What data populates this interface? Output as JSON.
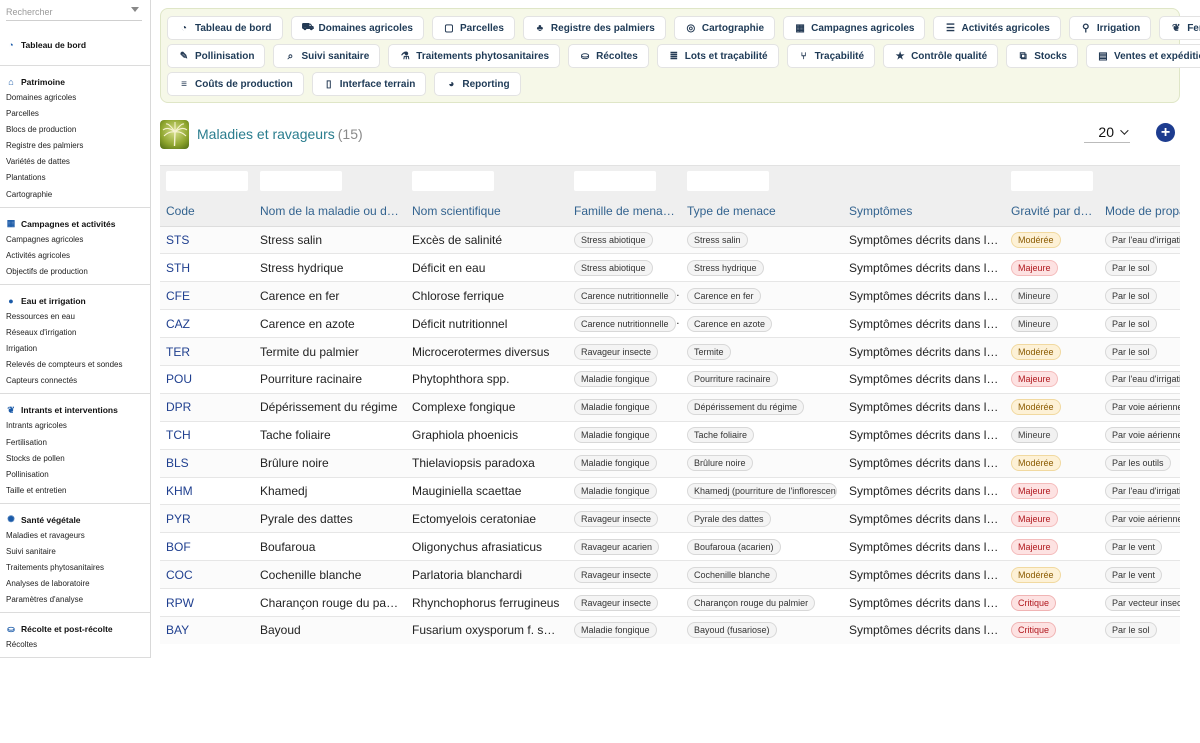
{
  "search": {
    "placeholder": "Rechercher"
  },
  "sidebar": {
    "top": {
      "label": "Tableau de bord",
      "icon": "gauge-icon"
    },
    "groups": [
      {
        "title": "Patrimoine",
        "icon": "building-icon",
        "items": [
          "Domaines agricoles",
          "Parcelles",
          "Blocs de production",
          "Registre des palmiers",
          "Variétés de dattes",
          "Plantations",
          "Cartographie"
        ]
      },
      {
        "title": "Campagnes et activités",
        "icon": "calendar-icon",
        "items": [
          "Campagnes agricoles",
          "Activités agricoles",
          "Objectifs de production"
        ]
      },
      {
        "title": "Eau et irrigation",
        "icon": "droplet-icon",
        "items": [
          "Ressources en eau",
          "Réseaux d'irrigation",
          "Irrigation",
          "Relevés de compteurs et sondes",
          "Capteurs connectés"
        ]
      },
      {
        "title": "Intrants et interventions",
        "icon": "leaf-icon",
        "items": [
          "Intrants agricoles",
          "Fertilisation",
          "Stocks de pollen",
          "Pollinisation",
          "Taille et entretien"
        ]
      },
      {
        "title": "Santé végétale",
        "icon": "virus-icon",
        "items": [
          "Maladies et ravageurs",
          "Suivi sanitaire",
          "Traitements phytosanitaires",
          "Analyses de laboratoire",
          "Paramètres d'analyse"
        ]
      },
      {
        "title": "Récolte et post-récolte",
        "icon": "basket-icon",
        "items": [
          "Récoltes"
        ]
      }
    ]
  },
  "toolbar": {
    "rows": [
      [
        {
          "label": "Tableau de bord",
          "icon": "gauge-icon",
          "glyph": "◔"
        },
        {
          "label": "Domaines agricoles",
          "icon": "tractor-icon",
          "glyph": "⛟"
        },
        {
          "label": "Parcelles",
          "icon": "border-icon",
          "glyph": "▢"
        },
        {
          "label": "Registre des palmiers",
          "icon": "tree-icon",
          "glyph": "♣"
        },
        {
          "label": "Cartographie",
          "icon": "compass-icon",
          "glyph": "◎"
        },
        {
          "label": "Campagnes agricoles",
          "icon": "calendar-icon",
          "glyph": "▦"
        },
        {
          "label": "Activités agricoles",
          "icon": "list-icon",
          "glyph": "☰"
        },
        {
          "label": "Irrigation",
          "icon": "faucet-icon",
          "glyph": "⚲"
        },
        {
          "label": "Fertilisation",
          "icon": "leaf-icon",
          "glyph": "❦"
        }
      ],
      [
        {
          "label": "Pollinisation",
          "icon": "brush-icon",
          "glyph": "✎"
        },
        {
          "label": "Suivi sanitaire",
          "icon": "search-icon",
          "glyph": "⌕"
        },
        {
          "label": "Traitements phytosanitaires",
          "icon": "spray-icon",
          "glyph": "⚗"
        },
        {
          "label": "Récoltes",
          "icon": "basket-icon",
          "glyph": "⛀"
        },
        {
          "label": "Lots et traçabilité",
          "icon": "list-icon",
          "glyph": "≣"
        },
        {
          "label": "Traçabilité",
          "icon": "sitemap-icon",
          "glyph": "⑂"
        },
        {
          "label": "Contrôle qualité",
          "icon": "star-icon",
          "glyph": "★"
        },
        {
          "label": "Stocks",
          "icon": "cubes-icon",
          "glyph": "⧉"
        },
        {
          "label": "Ventes et expéditions",
          "icon": "file-invoice-icon",
          "glyph": "▤"
        }
      ],
      [
        {
          "label": "Coûts de production",
          "icon": "coins-icon",
          "glyph": "≡"
        },
        {
          "label": "Interface terrain",
          "icon": "mobile-icon",
          "glyph": "▯"
        },
        {
          "label": "Reporting",
          "icon": "chart-pie-icon",
          "glyph": "◕"
        }
      ]
    ]
  },
  "header": {
    "title": "Maladies et ravageurs",
    "count": "(15)",
    "page_size": "20"
  },
  "table": {
    "columns": [
      "Code",
      "Nom de la maladie ou du ravageur",
      "Nom scientifique",
      "Famille de menace",
      "Type de menace",
      "Symptômes",
      "Gravité par défaut",
      "Mode de propagation"
    ],
    "rows": [
      {
        "code": "STS",
        "nom": "Stress salin",
        "sci": "Excès de salinité",
        "famille": "Stress abiotique",
        "type": "Stress salin",
        "symptomes": "Symptômes décrits dans la fiche",
        "gravite": "Modérée",
        "mode": "Par l'eau d'irrigation"
      },
      {
        "code": "STH",
        "nom": "Stress hydrique",
        "sci": "Déficit en eau",
        "famille": "Stress abiotique",
        "type": "Stress hydrique",
        "symptomes": "Symptômes décrits dans la fiche",
        "gravite": "Majeure",
        "mode": "Par le sol"
      },
      {
        "code": "CFE",
        "nom": "Carence en fer",
        "sci": "Chlorose ferrique",
        "famille": "Carence nutritionnelle",
        "type": "Carence en fer",
        "symptomes": "Symptômes décrits dans la fiche",
        "gravite": "Mineure",
        "mode": "Par le sol"
      },
      {
        "code": "CAZ",
        "nom": "Carence en azote",
        "sci": "Déficit nutritionnel",
        "famille": "Carence nutritionnelle",
        "type": "Carence en azote",
        "symptomes": "Symptômes décrits dans la fiche",
        "gravite": "Mineure",
        "mode": "Par le sol"
      },
      {
        "code": "TER",
        "nom": "Termite du palmier",
        "sci": "Microcerotermes diversus",
        "famille": "Ravageur insecte",
        "type": "Termite",
        "symptomes": "Symptômes décrits dans la fiche",
        "gravite": "Modérée",
        "mode": "Par le sol"
      },
      {
        "code": "POU",
        "nom": "Pourriture racinaire",
        "sci": "Phytophthora spp.",
        "famille": "Maladie fongique",
        "type": "Pourriture racinaire",
        "symptomes": "Symptômes décrits dans la fiche",
        "gravite": "Majeure",
        "mode": "Par l'eau d'irrigation"
      },
      {
        "code": "DPR",
        "nom": "Dépérissement du régime",
        "sci": "Complexe fongique",
        "famille": "Maladie fongique",
        "type": "Dépérissement du régime",
        "symptomes": "Symptômes décrits dans la fiche",
        "gravite": "Modérée",
        "mode": "Par voie aérienne"
      },
      {
        "code": "TCH",
        "nom": "Tache foliaire",
        "sci": "Graphiola phoenicis",
        "famille": "Maladie fongique",
        "type": "Tache foliaire",
        "symptomes": "Symptômes décrits dans la fiche",
        "gravite": "Mineure",
        "mode": "Par voie aérienne"
      },
      {
        "code": "BLS",
        "nom": "Brûlure noire",
        "sci": "Thielaviopsis paradoxa",
        "famille": "Maladie fongique",
        "type": "Brûlure noire",
        "symptomes": "Symptômes décrits dans la fiche",
        "gravite": "Modérée",
        "mode": "Par les outils"
      },
      {
        "code": "KHM",
        "nom": "Khamedj",
        "sci": "Mauginiella scaettae",
        "famille": "Maladie fongique",
        "type": "Khamedj (pourriture de l'inflorescence)",
        "symptomes": "Symptômes décrits dans la fiche",
        "gravite": "Majeure",
        "mode": "Par l'eau d'irrigation"
      },
      {
        "code": "PYR",
        "nom": "Pyrale des dattes",
        "sci": "Ectomyelois ceratoniae",
        "famille": "Ravageur insecte",
        "type": "Pyrale des dattes",
        "symptomes": "Symptômes décrits dans la fiche",
        "gravite": "Majeure",
        "mode": "Par voie aérienne"
      },
      {
        "code": "BOF",
        "nom": "Boufaroua",
        "sci": "Oligonychus afrasiaticus",
        "famille": "Ravageur acarien",
        "type": "Boufaroua (acarien)",
        "symptomes": "Symptômes décrits dans la fiche",
        "gravite": "Majeure",
        "mode": "Par le vent"
      },
      {
        "code": "COC",
        "nom": "Cochenille blanche",
        "sci": "Parlatoria blanchardi",
        "famille": "Ravageur insecte",
        "type": "Cochenille blanche",
        "symptomes": "Symptômes décrits dans la fiche",
        "gravite": "Modérée",
        "mode": "Par le vent"
      },
      {
        "code": "RPW",
        "nom": "Charançon rouge du palmier",
        "sci": "Rhynchophorus ferrugineus",
        "famille": "Ravageur insecte",
        "type": "Charançon rouge du palmier",
        "symptomes": "Symptômes décrits dans la fiche",
        "gravite": "Critique",
        "mode": "Par vecteur insecte"
      },
      {
        "code": "BAY",
        "nom": "Bayoud",
        "sci": "Fusarium oxysporum f. sp. albedinis",
        "famille": "Maladie fongique",
        "type": "Bayoud (fusariose)",
        "symptomes": "Symptômes décrits dans la fiche",
        "gravite": "Critique",
        "mode": "Par le sol"
      }
    ]
  },
  "colors": {
    "accent": "#2a7d8e",
    "code_link": "#1f3f8f",
    "add_button": "#1d3c8f",
    "toolbar_bg": "#f6f8e8"
  }
}
